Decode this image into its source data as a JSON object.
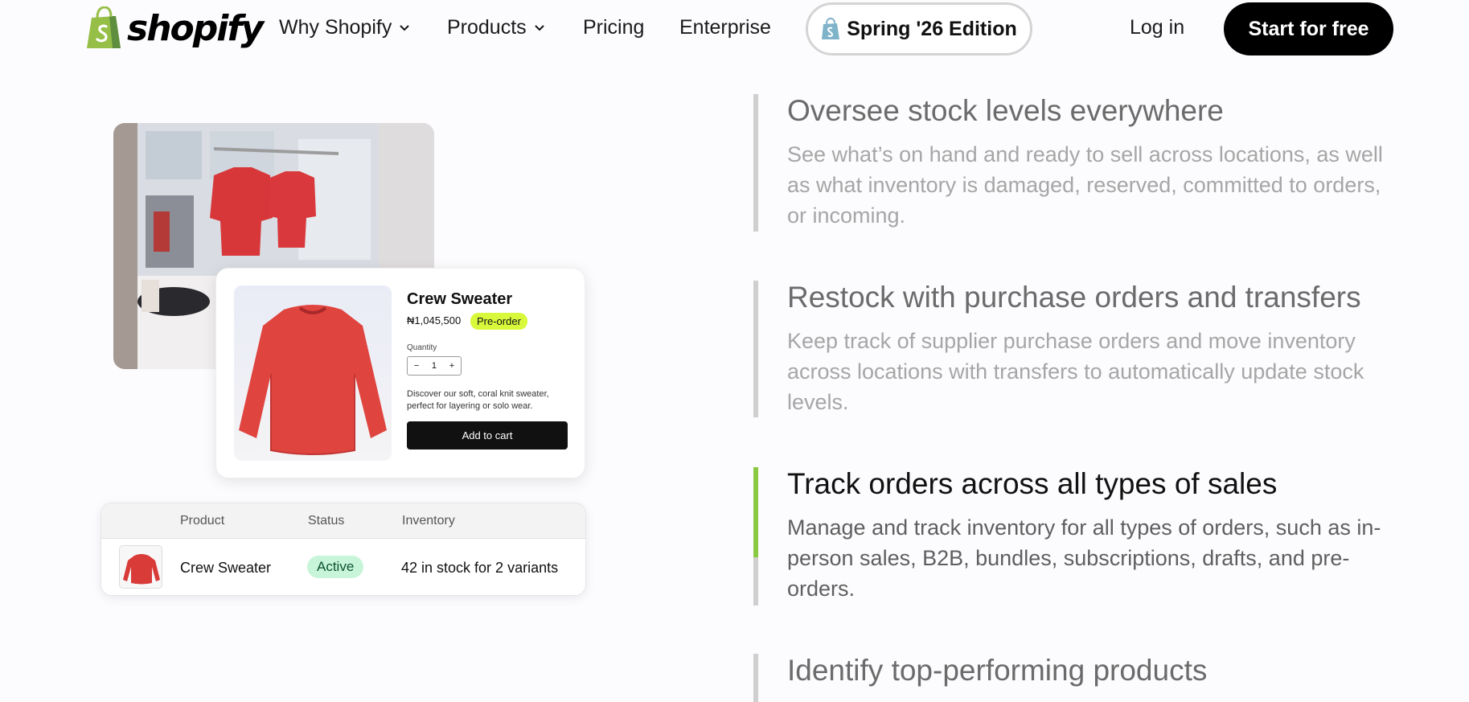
{
  "nav": {
    "brand": "shopify",
    "items": [
      {
        "label": "Why Shopify",
        "has_dropdown": true
      },
      {
        "label": "Products",
        "has_dropdown": true
      },
      {
        "label": "Pricing",
        "has_dropdown": false
      },
      {
        "label": "Enterprise",
        "has_dropdown": false
      }
    ],
    "edition_label": "Spring '26 Edition",
    "login_label": "Log in",
    "start_label": "Start for free"
  },
  "product_card": {
    "title": "Crew Sweater",
    "price": "₦1,045,500",
    "badge": "Pre-order",
    "quantity_label": "Quantity",
    "quantity_value": "1",
    "minus": "−",
    "plus": "+",
    "description": "Discover our soft, coral knit sweater, perfect for layering or solo wear.",
    "cart_label": "Add to cart"
  },
  "inventory_table": {
    "headers": [
      "Product",
      "Status",
      "Inventory"
    ],
    "row": {
      "product": "Crew Sweater",
      "status": "Active",
      "inventory": "42 in stock for 2 variants"
    }
  },
  "features": [
    {
      "title": "Oversee stock levels everywhere",
      "body": "See what’s on hand and ready to sell across locations, as well as what inventory is damaged, reserved, committed to orders, or incoming.",
      "active": false
    },
    {
      "title": "Restock with purchase orders and transfers",
      "body": "Keep track of supplier purchase orders and move inventory across locations with transfers to automatically update stock levels.",
      "active": false
    },
    {
      "title": "Track orders across all types of sales",
      "body": "Manage and track inventory for all types of orders, such as in-person sales, B2B, bundles, subscriptions, drafts, and pre-orders.",
      "active": true
    },
    {
      "title": "Identify top-performing products",
      "body": "",
      "active": false
    }
  ],
  "colors": {
    "accent_green": "#8ac942",
    "badge_lime": "#d8f93b",
    "status_green_bg": "#c8f5d9",
    "sweater_red": "#e0443f"
  }
}
